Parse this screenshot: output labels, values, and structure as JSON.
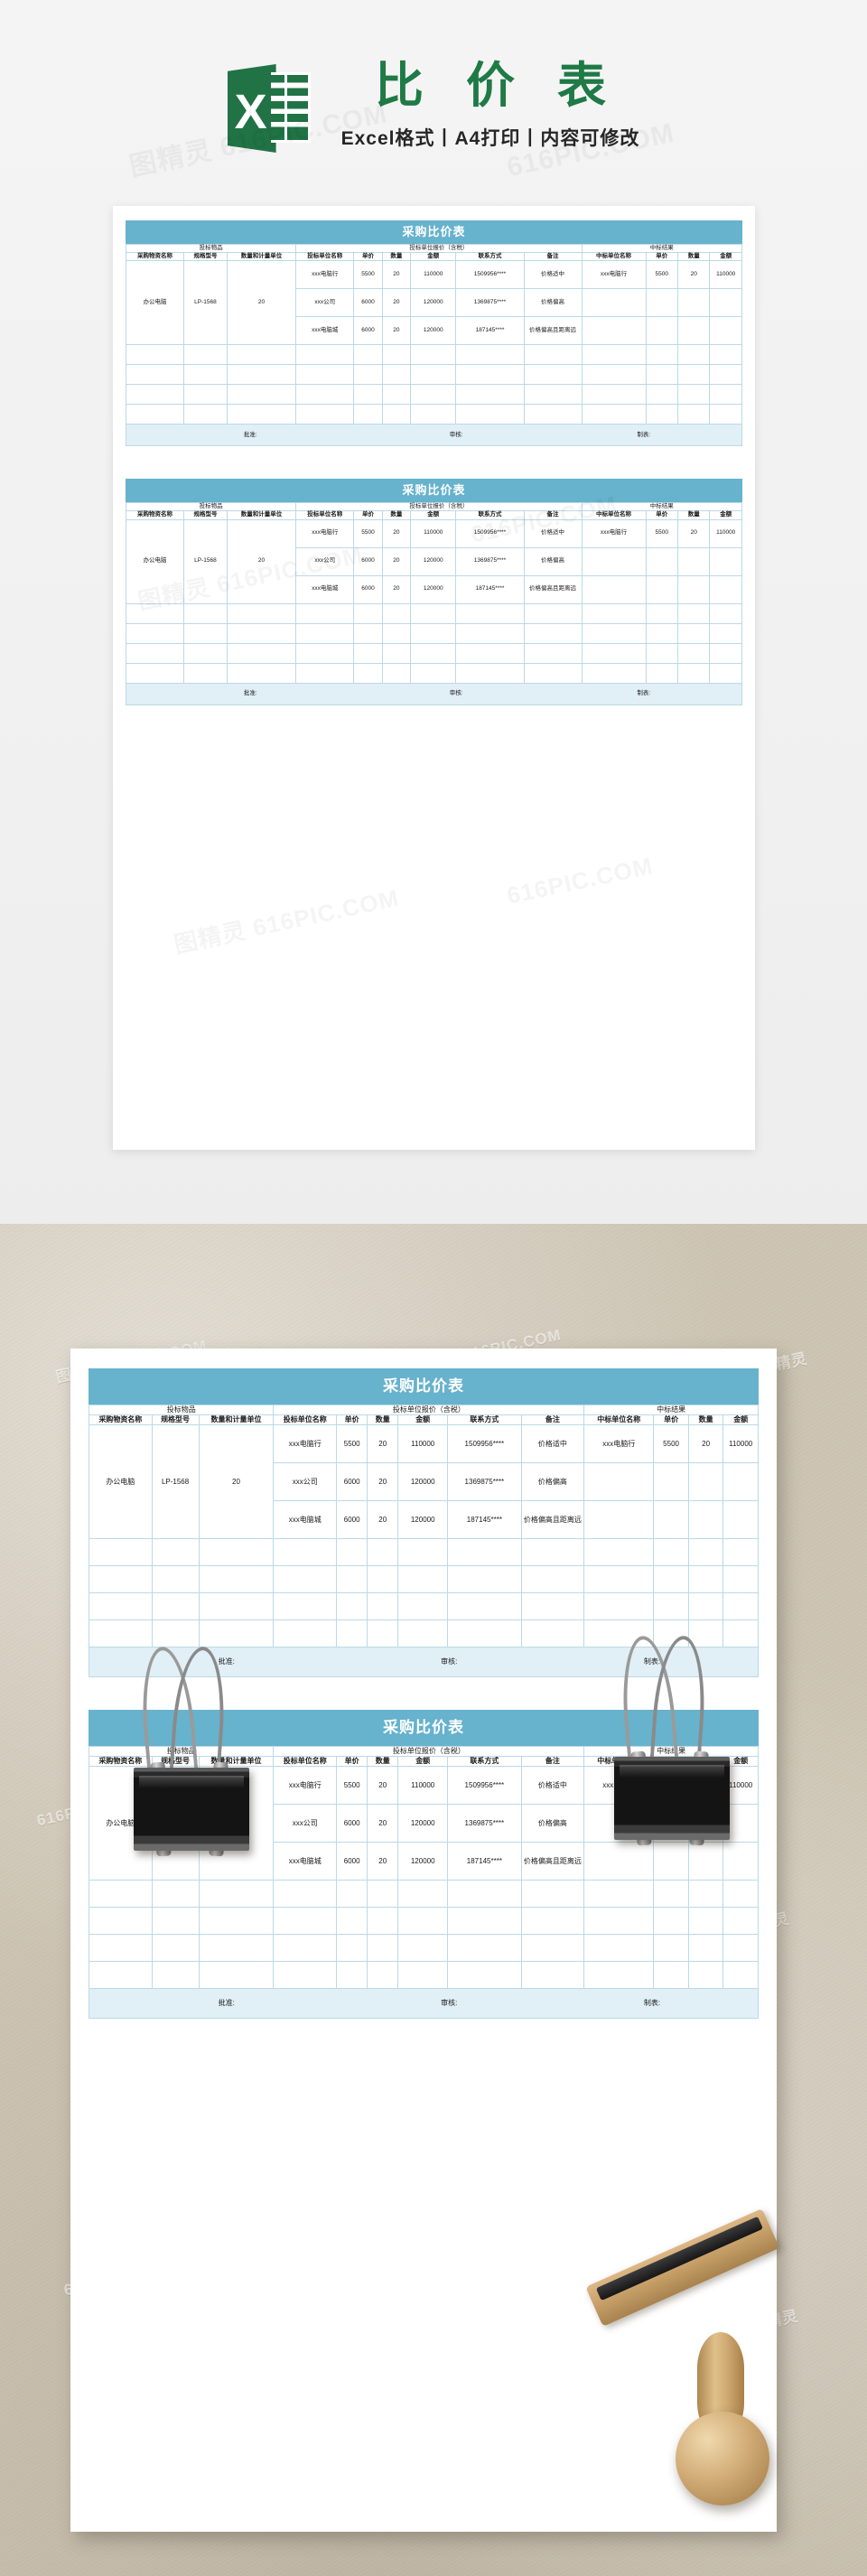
{
  "banner": {
    "logo_icon": "excel-logo-icon",
    "logo_letter": "X",
    "title": "比 价 表",
    "subtitle": "Excel格式丨A4打印丨内容可修改",
    "title_color": "#1f7a46"
  },
  "form": {
    "title": "采购比价表",
    "title_bg": "#67b2cd",
    "border_color": "#bcd9e6",
    "sign_band_bg": "#e1eff6",
    "group_headers": [
      {
        "label": "投标物品",
        "span": 3
      },
      {
        "label": "投标单位报价（含税）",
        "span": 6
      },
      {
        "label": "中标结果",
        "span": 4
      }
    ],
    "columns": [
      "采购物资名称",
      "规格型号",
      "数量和计量单位",
      "投标单位名称",
      "单价",
      "数量",
      "金额",
      "联系方式",
      "备注",
      "中标单位名称",
      "单价",
      "数量",
      "金额"
    ],
    "item": {
      "name": "办公电脑",
      "model": "LP-1568",
      "qty_unit": "20"
    },
    "bids": [
      {
        "bidder": "xxx电脑行",
        "unit_price": "5500",
        "qty": "20",
        "amount": "110000",
        "contact": "1509956****",
        "remark": "价格适中",
        "win_bidder": "xxx电脑行",
        "win_unit_price": "5500",
        "win_qty": "20",
        "win_amount": "110000"
      },
      {
        "bidder": "xxx公司",
        "unit_price": "6000",
        "qty": "20",
        "amount": "120000",
        "contact": "1369875****",
        "remark": "价格偏高",
        "win_bidder": "",
        "win_unit_price": "",
        "win_qty": "",
        "win_amount": ""
      },
      {
        "bidder": "xxx电脑城",
        "unit_price": "6000",
        "qty": "20",
        "amount": "120000",
        "contact": "187145****",
        "remark": "价格偏高且距离远",
        "win_bidder": "",
        "win_unit_price": "",
        "win_qty": "",
        "win_amount": ""
      }
    ],
    "blank_row_count": 4,
    "signatures": {
      "approve": "批准:",
      "review": "审核:",
      "prepare": "制表:"
    }
  },
  "mockup": {
    "background_color": "#cdc4b3",
    "paper_color": "#ffffff",
    "clip_left_icon": "binder-clip-icon",
    "clip_right_icon": "binder-clip-icon",
    "stamp_icon": "wooden-stamp-icon"
  },
  "watermarks": {
    "text_a": "图精灵 616PIC.COM",
    "text_b": "616PIC.COM",
    "text_c": "图精灵"
  }
}
